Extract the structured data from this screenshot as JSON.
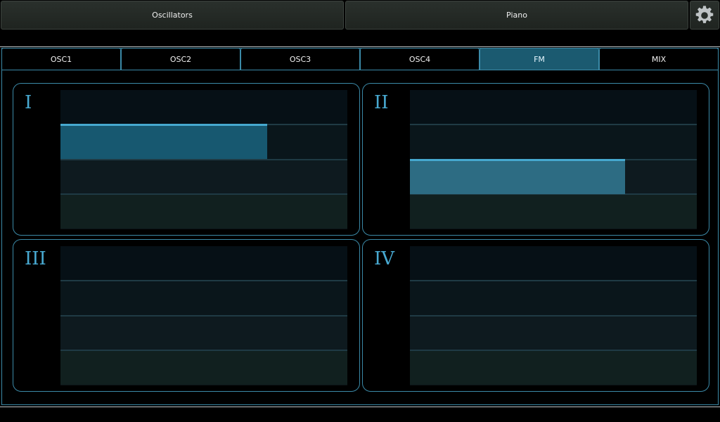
{
  "topbar": {
    "oscillators_label": "Oscillators",
    "piano_label": "Piano",
    "settings_icon": "gear-icon"
  },
  "tabs": [
    {
      "label": "OSC1",
      "active": false
    },
    {
      "label": "OSC2",
      "active": false
    },
    {
      "label": "OSC3",
      "active": false
    },
    {
      "label": "OSC4",
      "active": false
    },
    {
      "label": "FM",
      "active": true
    },
    {
      "label": "MIX",
      "active": false
    }
  ],
  "panels": [
    {
      "label": "I",
      "selected_row": 2,
      "level": 0.72
    },
    {
      "label": "II",
      "selected_row": 3,
      "level": 0.75
    },
    {
      "label": "III",
      "selected_row": null,
      "level": 0
    },
    {
      "label": "IV",
      "selected_row": null,
      "level": 0
    }
  ],
  "colors": {
    "accent": "#3b8aa8",
    "active_tab": "#1b5a70",
    "bar_fill_dark": "#175870",
    "bar_fill_light": "#2d6c83"
  }
}
